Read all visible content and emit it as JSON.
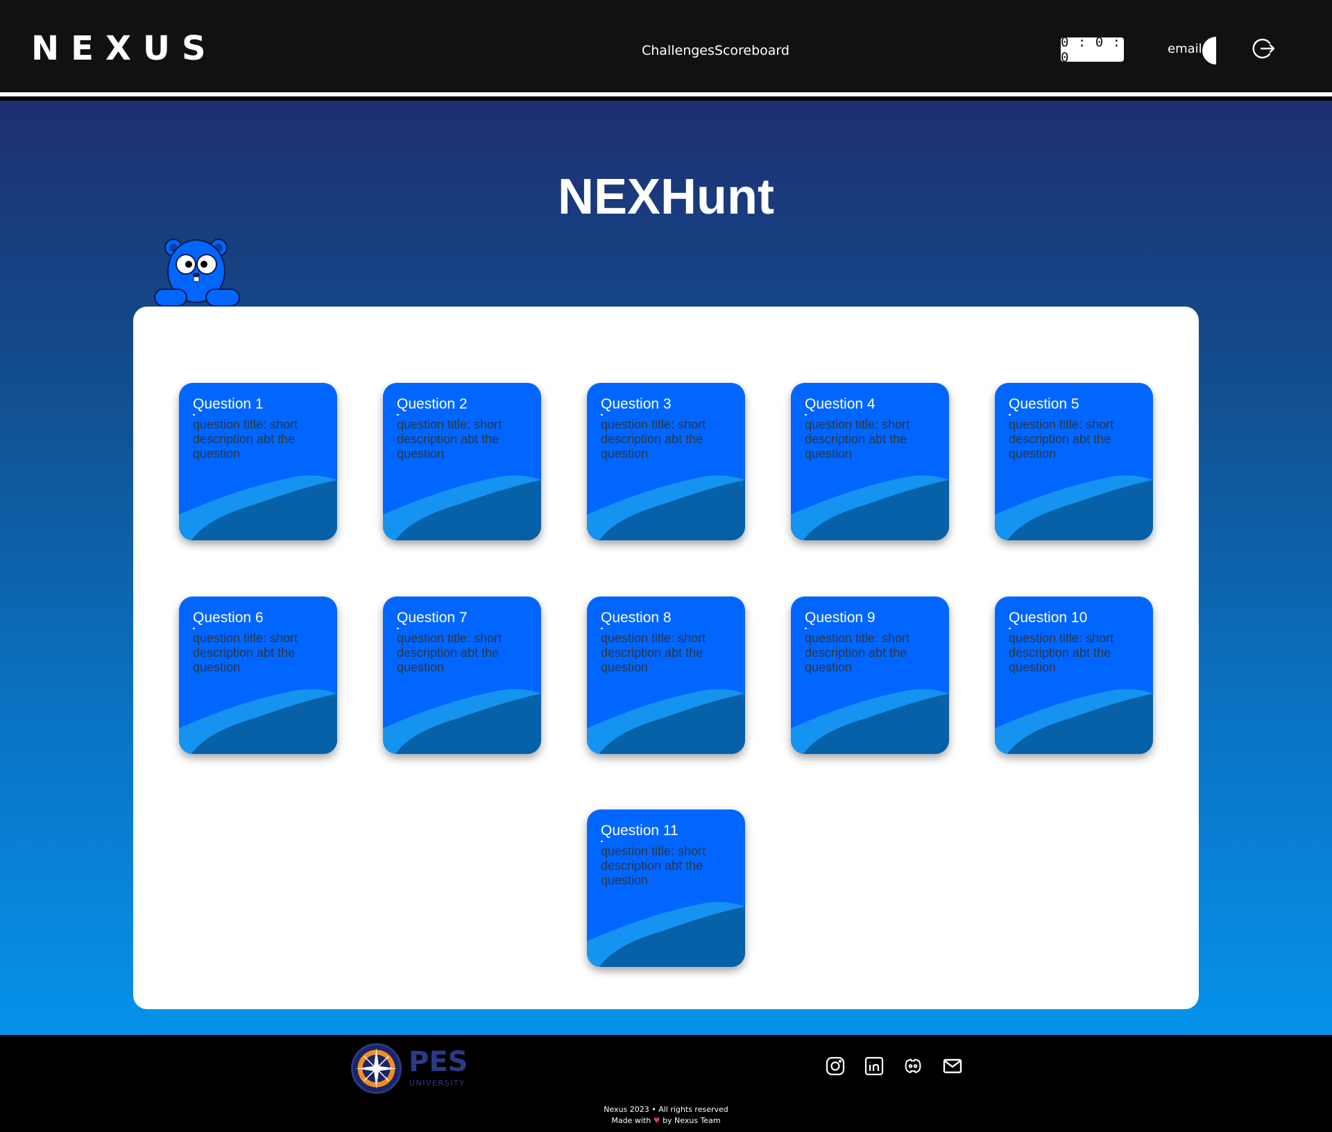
{
  "header": {
    "brand": "NEXUS",
    "nav": {
      "challenges": "Challenges",
      "scoreboard": "Scoreboard"
    },
    "timer": "0 : 0 : 0",
    "user_label": "email",
    "logout_icon": "logout-icon"
  },
  "main": {
    "title": "NEXHunt",
    "mascot_icon": "mascot-bear",
    "questions": [
      {
        "title": "Question 1",
        "description": "question title: short description abt the question"
      },
      {
        "title": "Question 2",
        "description": "question title: short description abt the question"
      },
      {
        "title": "Question 3",
        "description": "question title: short description abt the question"
      },
      {
        "title": "Question 4",
        "description": "question title: short description abt the question"
      },
      {
        "title": "Question 5",
        "description": "question title: short description abt the question"
      },
      {
        "title": "Question 6",
        "description": "question title: short description abt the question"
      },
      {
        "title": "Question 7",
        "description": "question title: short description abt the question"
      },
      {
        "title": "Question 8",
        "description": "question title: short description abt the question"
      },
      {
        "title": "Question 9",
        "description": "question title: short description abt the question"
      },
      {
        "title": "Question 10",
        "description": "question title: short description abt the question"
      },
      {
        "title": "Question 11",
        "description": "question title: short description abt the question"
      }
    ]
  },
  "footer": {
    "org_name": "PES",
    "org_sub": "UNIVERSITY",
    "social": [
      "instagram-icon",
      "linkedin-icon",
      "discord-icon",
      "mail-icon"
    ],
    "copyright": "Nexus 2023 • All rights reserved",
    "made_with_prefix": "Made with",
    "made_with_suffix": "by Nexus Team"
  },
  "colors": {
    "header_bg": "#111111",
    "card_bg": "#0066ff",
    "card_wave_light": "#1593f0",
    "card_wave_dark": "#0661a8",
    "heart": "#e8335a",
    "pes_brand": "#2c3a86"
  }
}
